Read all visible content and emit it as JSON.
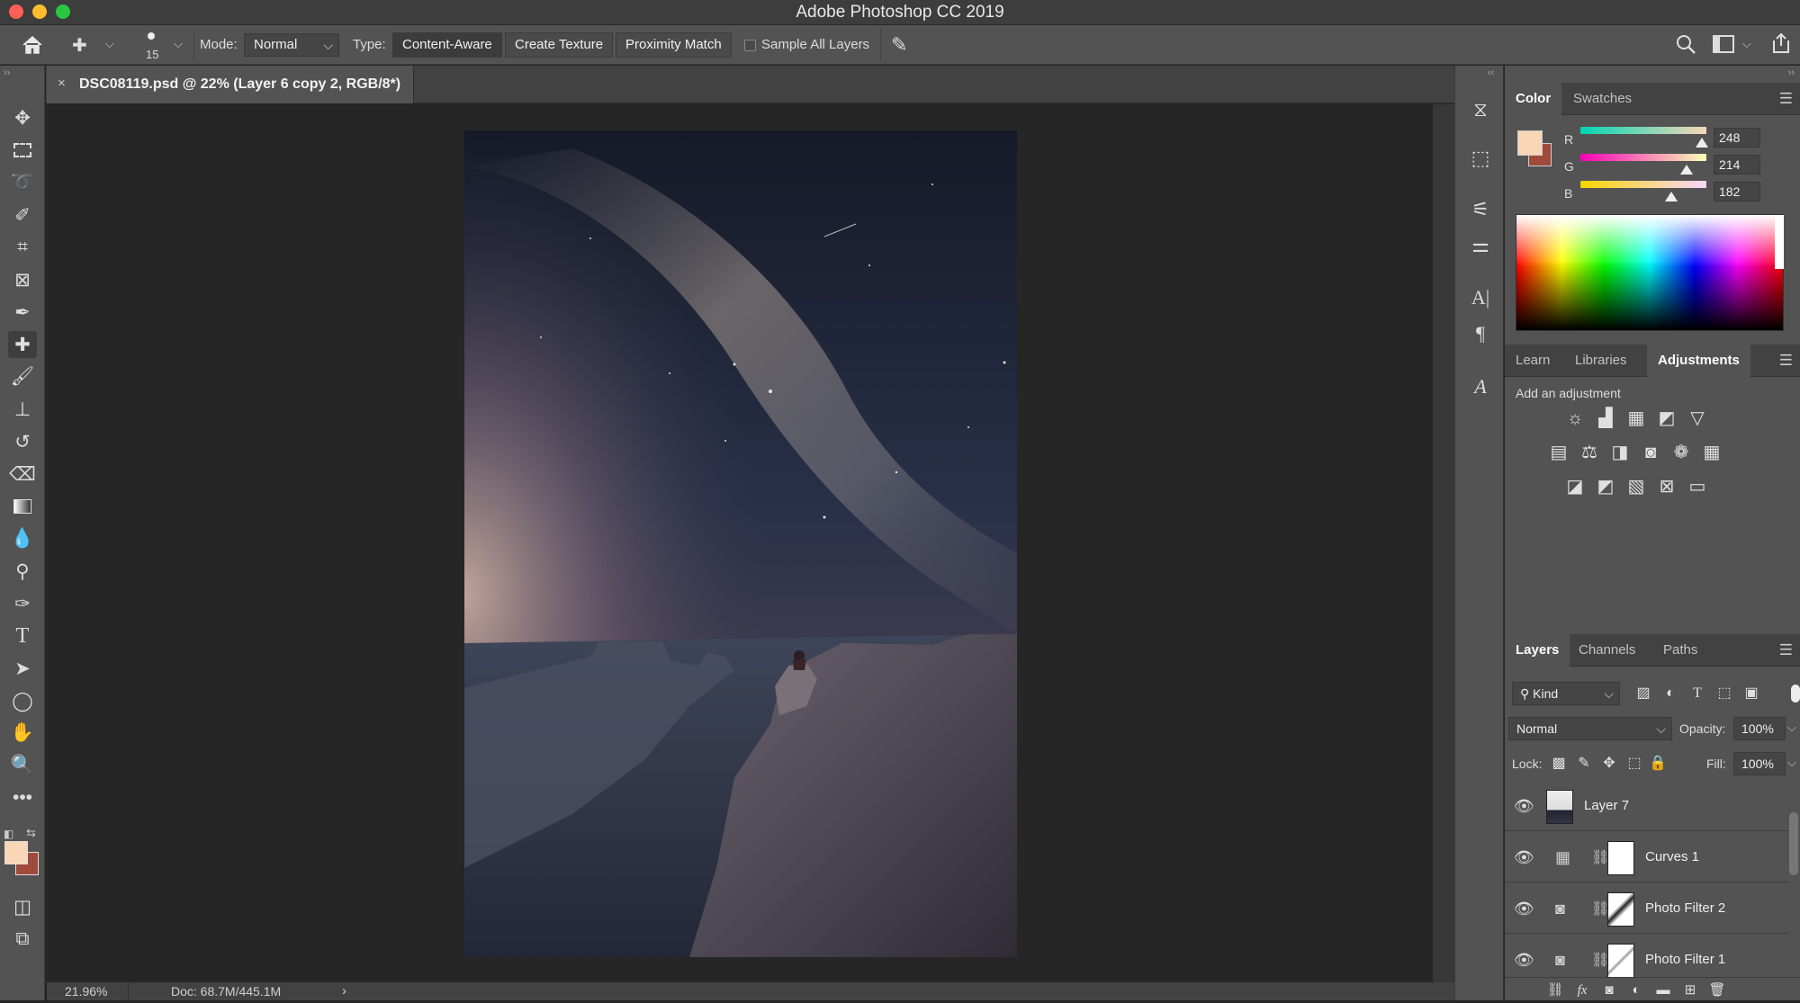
{
  "app": {
    "title": "Adobe Photoshop CC 2019"
  },
  "options": {
    "brush_size": "15",
    "mode_label": "Mode:",
    "mode_value": "Normal",
    "type_label": "Type:",
    "type_buttons": [
      "Content-Aware",
      "Create Texture",
      "Proximity Match"
    ],
    "sample_all_layers": "Sample All Layers"
  },
  "document": {
    "tab_title": "DSC08119.psd @ 22% (Layer 6 copy 2, RGB/8*)",
    "zoom": "21.96%",
    "doc_size": "Doc: 68.7M/445.1M"
  },
  "color_panel": {
    "tabs": [
      "Color",
      "Swatches"
    ],
    "r_label": "R",
    "g_label": "G",
    "b_label": "B",
    "r": "248",
    "g": "214",
    "b": "182",
    "foreground": "#f8d6b6",
    "background": "#a04a3c"
  },
  "adjust_panel": {
    "tabs": [
      "Learn",
      "Libraries",
      "Adjustments"
    ],
    "heading": "Add an adjustment"
  },
  "layers_panel": {
    "tabs": [
      "Layers",
      "Channels",
      "Paths"
    ],
    "filter": "Kind",
    "blend_mode": "Normal",
    "opacity_label": "Opacity:",
    "opacity": "100%",
    "lock_label": "Lock:",
    "fill_label": "Fill:",
    "fill": "100%",
    "layers": [
      "Layer 7",
      "Curves 1",
      "Photo Filter 2",
      "Photo Filter 1"
    ]
  }
}
